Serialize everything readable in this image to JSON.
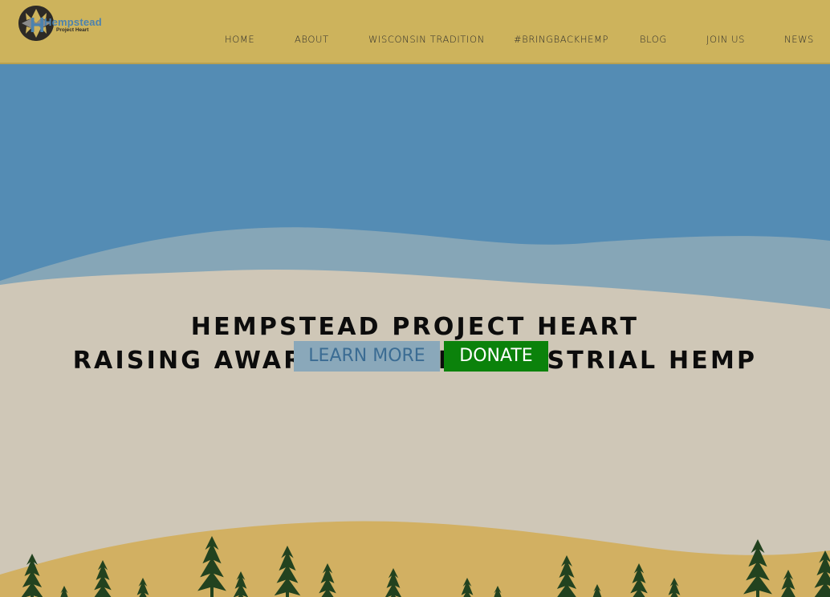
{
  "site": {
    "logo_title": "Hempstead",
    "logo_subtitle": "Project Heart"
  },
  "nav": [
    {
      "label": "HOME"
    },
    {
      "label": "ABOUT"
    },
    {
      "label": "WISCONSIN TRADITION"
    },
    {
      "label": "#BRINGBACKHEMP"
    },
    {
      "label": "BLOG"
    },
    {
      "label": "JOIN US"
    },
    {
      "label": "NEWS"
    }
  ],
  "hero": {
    "line1": "HEMPSTEAD PROJECT HEART",
    "line2": "RAISING AWARENESS OF INDUSTRIAL HEMP",
    "learn_more": "LEARN MORE",
    "donate": "DONATE"
  },
  "colors": {
    "header": "#cdb35c",
    "sky": "#548cb4",
    "hill_light": "#cfc7b7",
    "hill_gold": "#d2b062",
    "plant": "#22421f",
    "donate": "#0b820b",
    "learn_more": "#8aa8ba"
  }
}
